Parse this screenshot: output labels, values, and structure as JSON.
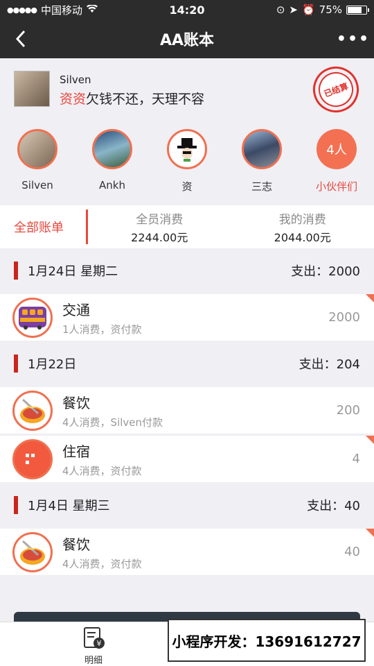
{
  "status": {
    "carrier": "中国移动",
    "time": "14:20",
    "battery": "75%",
    "battery_level": 0.75
  },
  "nav": {
    "title": "AA账本"
  },
  "profile": {
    "name": "Silven",
    "motto_scribble": "资资",
    "motto": "欠钱不还，天理不容",
    "stamp": "已结算"
  },
  "members": [
    {
      "label": "Silven"
    },
    {
      "label": "Ankh"
    },
    {
      "label": "资"
    },
    {
      "label": "三志"
    },
    {
      "label": "小伙伴们",
      "badge": "4人"
    }
  ],
  "tabs": {
    "all": "全部账单",
    "all_label": "全员消费",
    "all_value": "2244.00元",
    "mine_label": "我的消费",
    "mine_value": "2044.00元"
  },
  "sections": [
    {
      "date": "1月24日  星期二",
      "total": "支出：2000",
      "items": [
        {
          "title": "交通",
          "sub": "1人消费，资付款",
          "amount": "2000",
          "icon": "bus-icon"
        }
      ]
    },
    {
      "date": "1月22日",
      "total": "支出：204",
      "items": [
        {
          "title": "餐饮",
          "sub": "4人消费，Silven付款",
          "amount": "200",
          "icon": "food-icon"
        },
        {
          "title": "住宿",
          "sub": "4人消费，资付款",
          "amount": "4",
          "icon": "hotel-icon"
        }
      ]
    },
    {
      "date": "1月4日  星期三",
      "total": "支出：40",
      "items": [
        {
          "title": "餐饮",
          "sub": "4人消费，资付款",
          "amount": "40",
          "icon": "food-icon"
        }
      ]
    }
  ],
  "tabbar": {
    "detail_label": "明细",
    "detail_icon_char": "¥"
  },
  "promo": {
    "text": "小程序开发：13691612727"
  }
}
